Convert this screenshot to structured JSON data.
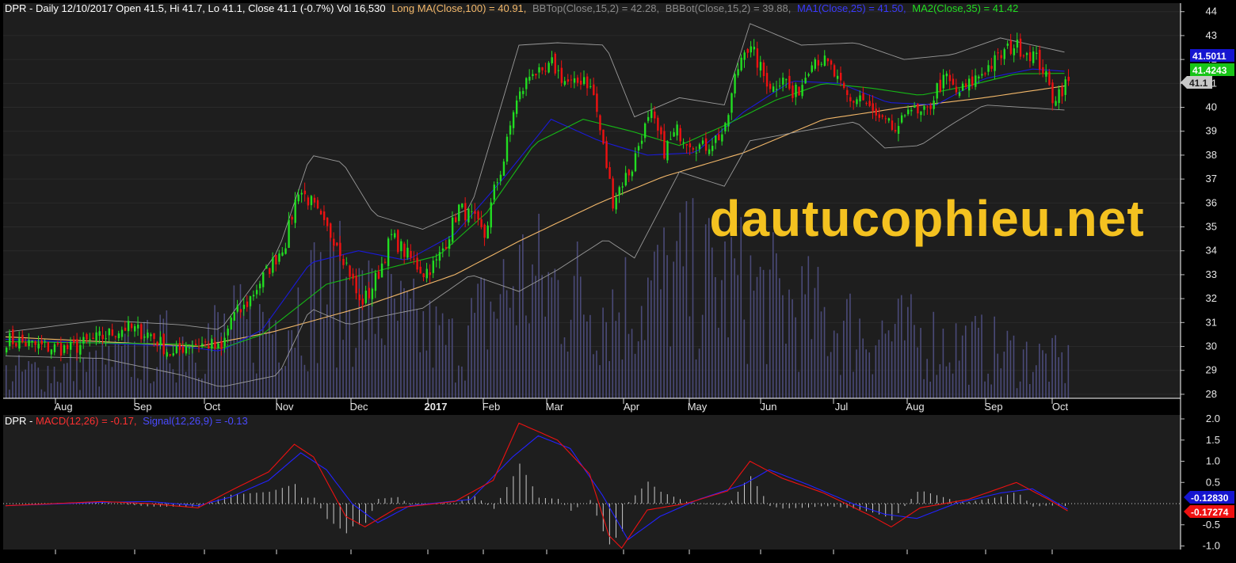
{
  "header": {
    "title": "DPR - Daily 12/10/2017 Open 41.5, Hi 41.7, Lo 41.1, Close 41.1 (-0.7%) Vol 16,530",
    "long_ma": "Long MA(Close,100) = 40.91,",
    "bbtop": "BBTop(Close,15,2) = 42.28,",
    "bbbot": "BBBot(Close,15,2) = 39.88,",
    "ma1": "MA1(Close,25) = 41.50,",
    "ma2": "MA2(Close,35) = 41.42"
  },
  "macd_header": {
    "prefix": "DPR - ",
    "macd": "MACD(12,26) = -0.17,",
    "signal": "Signal(12,26,9) = -0.13"
  },
  "watermark": "dautucophieu.net",
  "price_tags": {
    "ma1": "41.5011",
    "ma2": "41.4243",
    "close": "41.1"
  },
  "macd_tags": {
    "signal": "-0.12830",
    "macd": "-0.17274"
  },
  "colors": {
    "background": "#000000",
    "panel": "#1e1e1e",
    "up": "#22dd22",
    "down": "#ee1111",
    "long_ma": "#f3b86a",
    "ma1": "#1a1ad8",
    "ma2": "#16b816",
    "bollinger": "#9a9a9a",
    "volume": "#4a4a78",
    "macd": "#ee1111",
    "signal": "#2222ff",
    "histogram": "#c8c8c8",
    "watermark": "#f4c220"
  },
  "chart_data": [
    {
      "type": "candlestick",
      "title": "DPR - Daily 12/10/2017",
      "y_ticks": [
        28,
        29,
        30,
        31,
        32,
        33,
        34,
        35,
        36,
        37,
        38,
        39,
        40,
        41,
        42,
        43,
        44
      ],
      "ylim": [
        27.6,
        44.6
      ],
      "months": [
        "Aug",
        "Sep",
        "Oct",
        "Nov",
        "Dec",
        "2017",
        "Feb",
        "Mar",
        "Apr",
        "May",
        "Jun",
        "Jul",
        "Aug",
        "Sep",
        "Oct"
      ],
      "anchors": [
        [
          0,
          30.3
        ],
        [
          10,
          30.0
        ],
        [
          20,
          29.9
        ],
        [
          30,
          30.4
        ],
        [
          37,
          30.8
        ],
        [
          45,
          30.5
        ],
        [
          52,
          29.6
        ],
        [
          56,
          30.1
        ],
        [
          63,
          30.1
        ],
        [
          67,
          29.8
        ],
        [
          70,
          31.2
        ],
        [
          74,
          31.6
        ],
        [
          79,
          32.7
        ],
        [
          83,
          33.5
        ],
        [
          87,
          34.4
        ],
        [
          91,
          36.6
        ],
        [
          95,
          36.0
        ],
        [
          99,
          35.0
        ],
        [
          103,
          34.4
        ],
        [
          107,
          33.1
        ],
        [
          110,
          31.8
        ],
        [
          113,
          32.2
        ],
        [
          116,
          33.1
        ],
        [
          120,
          34.6
        ],
        [
          125,
          33.8
        ],
        [
          130,
          33.1
        ],
        [
          134,
          33.5
        ],
        [
          137,
          34.4
        ],
        [
          141,
          35.8
        ],
        [
          145,
          35.4
        ],
        [
          149,
          34.6
        ],
        [
          152,
          36.5
        ],
        [
          155,
          37.8
        ],
        [
          158,
          39.9
        ],
        [
          161,
          40.8
        ],
        [
          164,
          41.6
        ],
        [
          167,
          41.2
        ],
        [
          170,
          41.8
        ],
        [
          174,
          41.1
        ],
        [
          177,
          40.9
        ],
        [
          180,
          41.3
        ],
        [
          183,
          40.5
        ],
        [
          186,
          38.3
        ],
        [
          189,
          36.1
        ],
        [
          192,
          36.9
        ],
        [
          195,
          37.5
        ],
        [
          198,
          38.9
        ],
        [
          201,
          39.6
        ],
        [
          205,
          38.2
        ],
        [
          209,
          39.0
        ],
        [
          213,
          38.6
        ],
        [
          217,
          38.3
        ],
        [
          221,
          38.7
        ],
        [
          224,
          39.0
        ],
        [
          227,
          41.2
        ],
        [
          230,
          42.6
        ],
        [
          233,
          42.2
        ],
        [
          236,
          41.3
        ],
        [
          239,
          40.8
        ],
        [
          242,
          41.4
        ],
        [
          245,
          40.4
        ],
        [
          248,
          41.0
        ],
        [
          251,
          42.1
        ],
        [
          254,
          42.0
        ],
        [
          257,
          41.6
        ],
        [
          260,
          40.8
        ],
        [
          263,
          40.2
        ],
        [
          266,
          40.5
        ],
        [
          269,
          39.9
        ],
        [
          272,
          39.4
        ],
        [
          275,
          39.2
        ],
        [
          278,
          38.9
        ],
        [
          281,
          40.2
        ],
        [
          284,
          39.6
        ],
        [
          287,
          39.8
        ],
        [
          290,
          40.8
        ],
        [
          293,
          41.2
        ],
        [
          296,
          40.6
        ],
        [
          299,
          40.8
        ],
        [
          302,
          41.2
        ],
        [
          305,
          41.6
        ],
        [
          308,
          41.9
        ],
        [
          311,
          42.3
        ],
        [
          314,
          42.6
        ],
        [
          317,
          42.4
        ],
        [
          320,
          42.2
        ],
        [
          323,
          41.6
        ],
        [
          326,
          40.4
        ],
        [
          329,
          40.8
        ],
        [
          331,
          41.1
        ]
      ],
      "series": [
        {
          "name": "Long MA(Close,100)",
          "values": [
            [
              0,
              30.4
            ],
            [
              60,
              30.0
            ],
            [
              83,
              30.6
            ],
            [
              110,
              31.6
            ],
            [
              140,
              33.0
            ],
            [
              160,
              34.4
            ],
            [
              185,
              36.0
            ],
            [
              205,
              37.1
            ],
            [
              230,
              38.1
            ],
            [
              255,
              39.5
            ],
            [
              280,
              40.0
            ],
            [
              305,
              40.4
            ],
            [
              331,
              40.91
            ]
          ]
        },
        {
          "name": "BBTop(Close,15,2)",
          "values": [
            [
              0,
              30.6
            ],
            [
              30,
              31.1
            ],
            [
              55,
              30.9
            ],
            [
              67,
              30.7
            ],
            [
              85,
              34.0
            ],
            [
              95,
              38.0
            ],
            [
              105,
              37.7
            ],
            [
              115,
              35.5
            ],
            [
              130,
              34.9
            ],
            [
              145,
              35.8
            ],
            [
              160,
              42.6
            ],
            [
              172,
              42.7
            ],
            [
              187,
              42.6
            ],
            [
              196,
              39.6
            ],
            [
              210,
              40.4
            ],
            [
              224,
              40.1
            ],
            [
              232,
              43.5
            ],
            [
              248,
              42.6
            ],
            [
              265,
              42.7
            ],
            [
              280,
              42.0
            ],
            [
              295,
              42.2
            ],
            [
              310,
              42.9
            ],
            [
              331,
              42.28
            ]
          ]
        },
        {
          "name": "BBBot(Close,15,2)",
          "values": [
            [
              0,
              29.6
            ],
            [
              30,
              29.5
            ],
            [
              55,
              28.8
            ],
            [
              67,
              28.3
            ],
            [
              85,
              28.8
            ],
            [
              95,
              31.6
            ],
            [
              107,
              30.9
            ],
            [
              115,
              31.2
            ],
            [
              130,
              31.6
            ],
            [
              145,
              33.0
            ],
            [
              160,
              32.3
            ],
            [
              172,
              33.2
            ],
            [
              187,
              34.5
            ],
            [
              196,
              33.7
            ],
            [
              210,
              37.3
            ],
            [
              224,
              36.7
            ],
            [
              232,
              38.6
            ],
            [
              248,
              39.0
            ],
            [
              265,
              39.4
            ],
            [
              274,
              38.3
            ],
            [
              285,
              38.4
            ],
            [
              295,
              39.3
            ],
            [
              305,
              40.1
            ],
            [
              331,
              39.88
            ]
          ]
        },
        {
          "name": "MA1(Close,25)",
          "values": [
            [
              0,
              30.3
            ],
            [
              55,
              30.0
            ],
            [
              67,
              29.8
            ],
            [
              80,
              30.7
            ],
            [
              95,
              33.5
            ],
            [
              110,
              34.0
            ],
            [
              125,
              33.6
            ],
            [
              140,
              34.7
            ],
            [
              155,
              37.0
            ],
            [
              170,
              39.5
            ],
            [
              185,
              38.6
            ],
            [
              200,
              38.0
            ],
            [
              215,
              38.1
            ],
            [
              230,
              39.8
            ],
            [
              245,
              41.1
            ],
            [
              260,
              41.0
            ],
            [
              275,
              40.2
            ],
            [
              290,
              40.1
            ],
            [
              305,
              41.2
            ],
            [
              320,
              41.6
            ],
            [
              331,
              41.5
            ]
          ]
        },
        {
          "name": "MA2(Close,35)",
          "values": [
            [
              0,
              30.2
            ],
            [
              55,
              30.1
            ],
            [
              67,
              29.9
            ],
            [
              80,
              30.5
            ],
            [
              100,
              32.6
            ],
            [
              120,
              33.3
            ],
            [
              135,
              33.8
            ],
            [
              150,
              35.6
            ],
            [
              165,
              38.5
            ],
            [
              180,
              39.5
            ],
            [
              195,
              39.0
            ],
            [
              210,
              38.4
            ],
            [
              225,
              39.3
            ],
            [
              240,
              40.3
            ],
            [
              255,
              41.0
            ],
            [
              270,
              40.8
            ],
            [
              285,
              40.5
            ],
            [
              300,
              40.9
            ],
            [
              315,
              41.4
            ],
            [
              331,
              41.42
            ]
          ]
        }
      ],
      "volume_profile": [
        [
          0,
          1.5
        ],
        [
          30,
          2.0
        ],
        [
          60,
          3.5
        ],
        [
          80,
          4.0
        ],
        [
          100,
          6.0
        ],
        [
          140,
          3.0
        ],
        [
          160,
          6.5
        ],
        [
          190,
          5.0
        ],
        [
          210,
          6.5
        ],
        [
          230,
          6.0
        ],
        [
          260,
          4.0
        ],
        [
          300,
          3.0
        ],
        [
          331,
          2.0
        ]
      ]
    },
    {
      "type": "line",
      "title": "DPR - MACD(12,26)",
      "y_ticks": [
        2.0,
        1.5,
        1.0,
        0.5,
        -0.5,
        -1.0
      ],
      "ylim": [
        -1.15,
        2.1
      ],
      "series": [
        {
          "name": "MACD(12,26)",
          "values": [
            [
              0,
              -0.05
            ],
            [
              30,
              0.05
            ],
            [
              45,
              0.0
            ],
            [
              60,
              -0.1
            ],
            [
              70,
              0.3
            ],
            [
              82,
              0.75
            ],
            [
              90,
              1.4
            ],
            [
              96,
              1.1
            ],
            [
              106,
              -0.3
            ],
            [
              112,
              -0.55
            ],
            [
              122,
              -0.1
            ],
            [
              140,
              0.05
            ],
            [
              152,
              0.55
            ],
            [
              160,
              1.9
            ],
            [
              172,
              1.5
            ],
            [
              182,
              0.7
            ],
            [
              188,
              -0.75
            ],
            [
              192,
              -1.05
            ],
            [
              200,
              -0.15
            ],
            [
              212,
              0.0
            ],
            [
              225,
              0.3
            ],
            [
              232,
              1.0
            ],
            [
              242,
              0.6
            ],
            [
              255,
              0.25
            ],
            [
              270,
              -0.3
            ],
            [
              276,
              -0.55
            ],
            [
              285,
              -0.1
            ],
            [
              300,
              0.1
            ],
            [
              315,
              0.5
            ],
            [
              325,
              0.1
            ],
            [
              331,
              -0.17
            ]
          ]
        },
        {
          "name": "Signal(12,26,9)",
          "values": [
            [
              0,
              -0.05
            ],
            [
              30,
              0.03
            ],
            [
              45,
              0.05
            ],
            [
              60,
              -0.05
            ],
            [
              70,
              0.15
            ],
            [
              82,
              0.55
            ],
            [
              92,
              1.2
            ],
            [
              100,
              0.8
            ],
            [
              108,
              0.0
            ],
            [
              116,
              -0.45
            ],
            [
              126,
              -0.05
            ],
            [
              145,
              0.1
            ],
            [
              158,
              1.1
            ],
            [
              166,
              1.6
            ],
            [
              176,
              1.3
            ],
            [
              186,
              0.2
            ],
            [
              194,
              -0.85
            ],
            [
              204,
              -0.3
            ],
            [
              216,
              0.1
            ],
            [
              230,
              0.45
            ],
            [
              238,
              0.8
            ],
            [
              250,
              0.45
            ],
            [
              264,
              0.0
            ],
            [
              274,
              -0.25
            ],
            [
              284,
              -0.35
            ],
            [
              296,
              0.0
            ],
            [
              310,
              0.25
            ],
            [
              320,
              0.35
            ],
            [
              331,
              -0.13
            ]
          ]
        }
      ]
    }
  ]
}
